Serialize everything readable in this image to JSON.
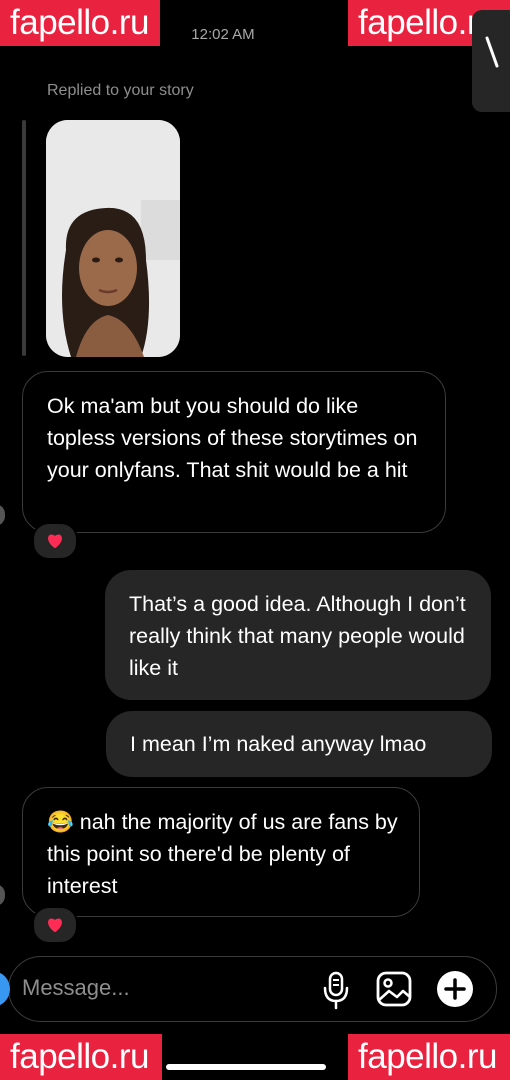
{
  "watermark": {
    "text": "fapello.ru"
  },
  "status": {
    "time": "12:02 AM"
  },
  "story_reply": {
    "label": "Replied to your story"
  },
  "messages": [
    {
      "side": "incoming",
      "text": "Ok ma'am but you should do like topless versions of these storytimes on your onlyfans. That shit would be a hit",
      "reaction": "❤️"
    },
    {
      "side": "outgoing",
      "text": "That’s a good idea. Although I don’t really think that many people would like it"
    },
    {
      "side": "outgoing",
      "text": "I mean I’m naked anyway lmao"
    },
    {
      "side": "incoming",
      "text": "😂 nah the majority of us are fans by this point so there'd be plenty of interest",
      "reaction": "❤️"
    }
  ],
  "composer": {
    "placeholder": "Message..."
  },
  "colors": {
    "watermark": "#e9233f",
    "outgoing_bubble": "#262626",
    "background": "#000000",
    "camera_button": "#3897f0"
  },
  "icons": [
    "mic-icon",
    "gallery-icon",
    "plus-icon",
    "heart-reaction-icon",
    "edit-icon"
  ]
}
